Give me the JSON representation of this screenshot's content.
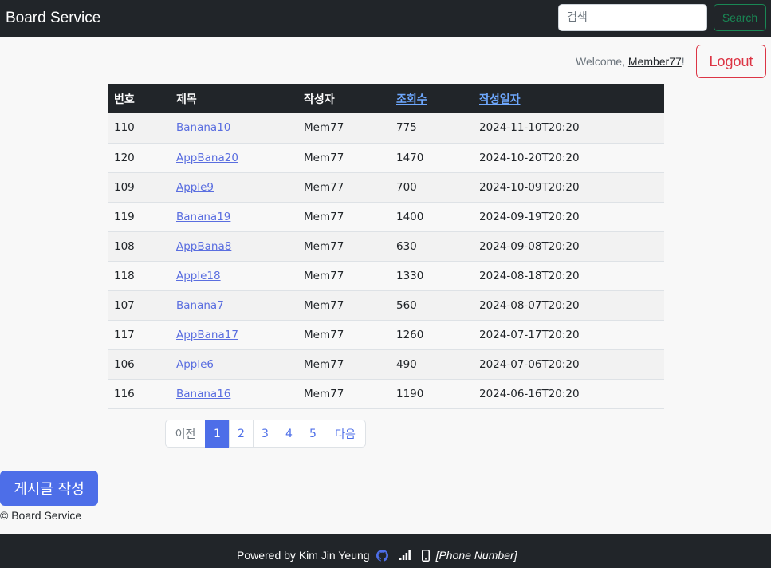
{
  "navbar": {
    "brand": "Board Service",
    "search_placeholder": "검색",
    "search_label": "Search"
  },
  "user": {
    "welcome_prefix": "Welcome, ",
    "username": "Member77",
    "welcome_suffix": "!",
    "logout_label": "Logout"
  },
  "table": {
    "headers": {
      "no": "번호",
      "title": "제목",
      "writer": "작성자",
      "views": "조회수",
      "date": "작성일자"
    },
    "rows": [
      {
        "no": "110",
        "title": "Banana10",
        "writer": "Mem77",
        "views": "775",
        "date": "2024-11-10T20:20"
      },
      {
        "no": "120",
        "title": "AppBana20",
        "writer": "Mem77",
        "views": "1470",
        "date": "2024-10-20T20:20"
      },
      {
        "no": "109",
        "title": "Apple9",
        "writer": "Mem77",
        "views": "700",
        "date": "2024-10-09T20:20"
      },
      {
        "no": "119",
        "title": "Banana19",
        "writer": "Mem77",
        "views": "1400",
        "date": "2024-09-19T20:20"
      },
      {
        "no": "108",
        "title": "AppBana8",
        "writer": "Mem77",
        "views": "630",
        "date": "2024-09-08T20:20"
      },
      {
        "no": "118",
        "title": "Apple18",
        "writer": "Mem77",
        "views": "1330",
        "date": "2024-08-18T20:20"
      },
      {
        "no": "107",
        "title": "Banana7",
        "writer": "Mem77",
        "views": "560",
        "date": "2024-08-07T20:20"
      },
      {
        "no": "117",
        "title": "AppBana17",
        "writer": "Mem77",
        "views": "1260",
        "date": "2024-07-17T20:20"
      },
      {
        "no": "106",
        "title": "Apple6",
        "writer": "Mem77",
        "views": "490",
        "date": "2024-07-06T20:20"
      },
      {
        "no": "116",
        "title": "Banana16",
        "writer": "Mem77",
        "views": "1190",
        "date": "2024-06-16T20:20"
      }
    ]
  },
  "pagination": {
    "prev": "이전",
    "pages": [
      "1",
      "2",
      "3",
      "4",
      "5"
    ],
    "active_page": "1",
    "next": "다음"
  },
  "actions": {
    "write_label": "게시글 작성"
  },
  "copyright": "© Board Service",
  "footer": {
    "powered_by": "Powered by Kim Jin Yeung",
    "phone": "[Phone Number]",
    "icons": [
      "github-icon",
      "signal-icon",
      "phone-icon"
    ]
  },
  "colors": {
    "navbar": "#212529",
    "accent": "#4d6ee8",
    "search": "#198754",
    "logout": "#dc3545"
  }
}
